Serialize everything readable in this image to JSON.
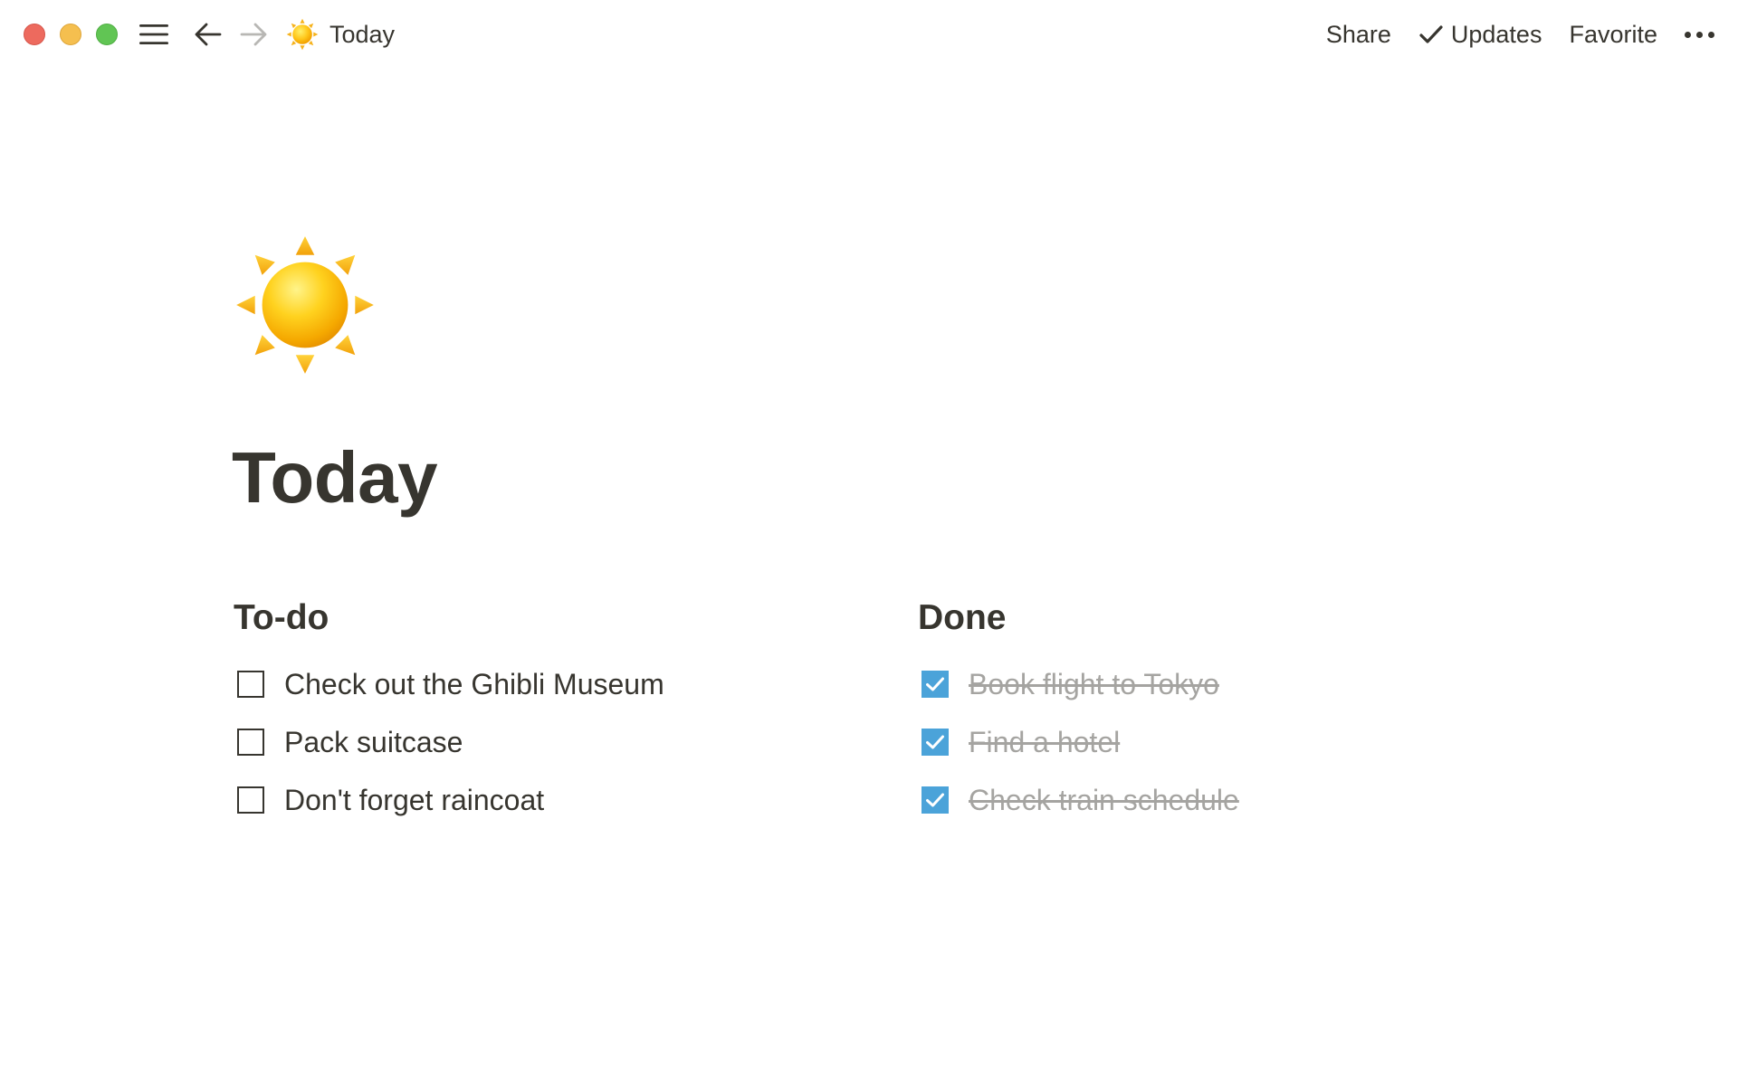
{
  "window": {
    "controls": [
      "close",
      "minimize",
      "zoom"
    ]
  },
  "nav": {
    "menu_icon": "hamburger-menu-icon",
    "back_icon": "arrow-left-icon",
    "forward_icon": "arrow-right-icon"
  },
  "breadcrumb": {
    "icon": "sun-emoji",
    "title": "Today"
  },
  "toolbar": {
    "share_label": "Share",
    "updates_label": "Updates",
    "favorite_label": "Favorite",
    "more_icon": "more-dots-icon"
  },
  "page": {
    "icon": "sun-emoji",
    "title": "Today"
  },
  "columns": [
    {
      "heading": "To-do",
      "items": [
        {
          "label": "Check out the Ghibli Museum",
          "checked": false
        },
        {
          "label": "Pack suitcase",
          "checked": false
        },
        {
          "label": "Don't forget raincoat",
          "checked": false
        }
      ]
    },
    {
      "heading": "Done",
      "items": [
        {
          "label": "Book flight to Tokyo",
          "checked": true
        },
        {
          "label": "Find a hotel",
          "checked": true
        },
        {
          "label": "Check train schedule",
          "checked": true
        }
      ]
    }
  ],
  "colors": {
    "text": "#37352f",
    "muted_text": "#a5a4a1",
    "checkbox_checked": "#4ba3d9",
    "close": "#ed6a5e",
    "minimize": "#f5bf4f",
    "zoom": "#61c554"
  }
}
